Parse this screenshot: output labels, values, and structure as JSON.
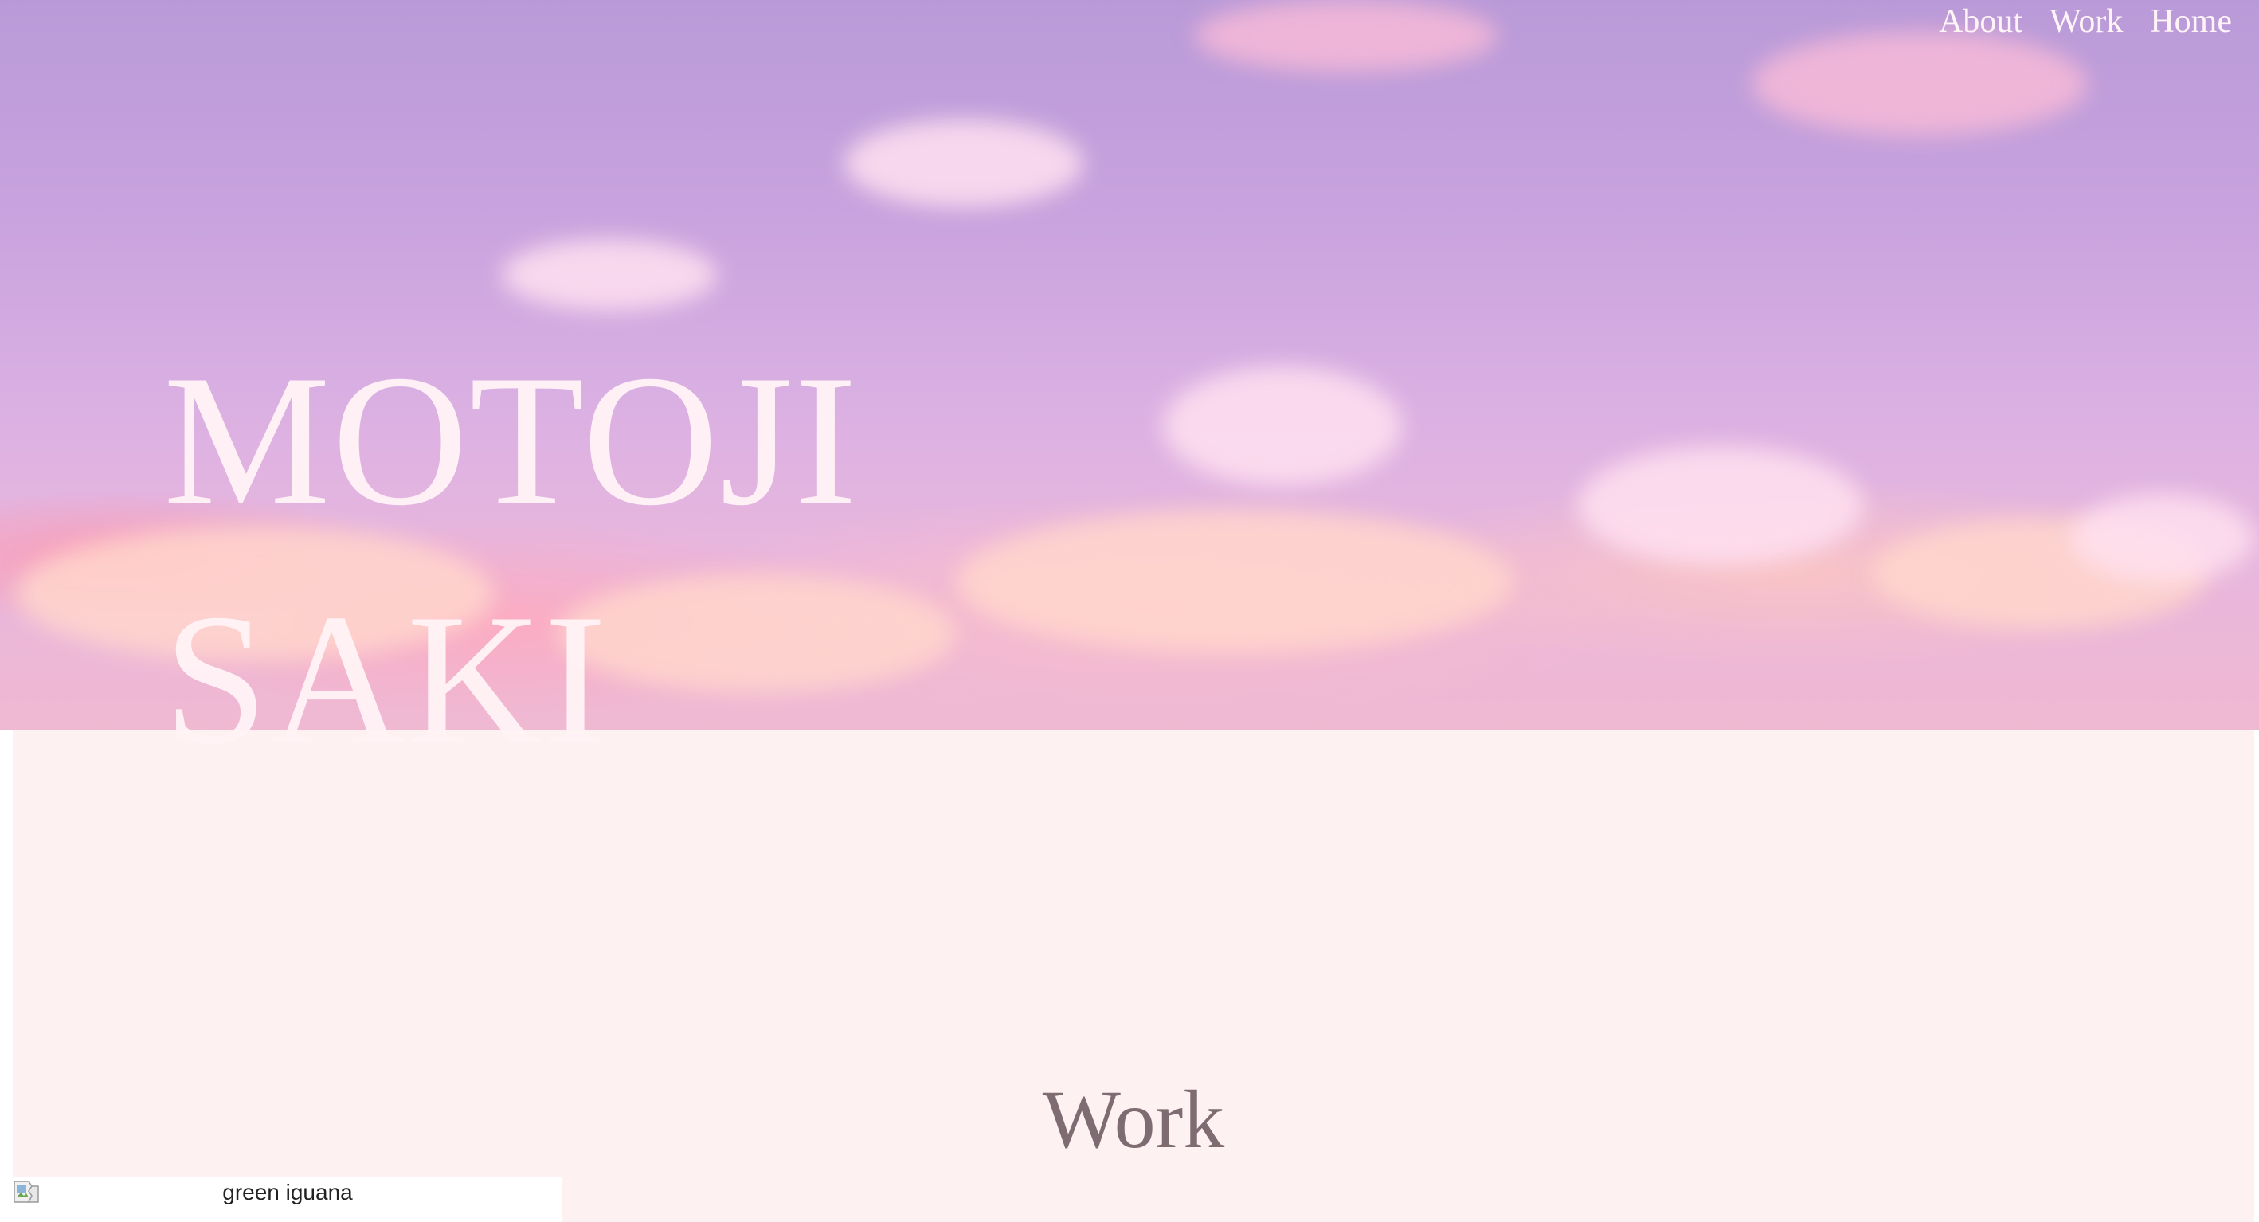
{
  "nav": {
    "items": [
      {
        "label": "About"
      },
      {
        "label": "Work"
      },
      {
        "label": "Home"
      }
    ]
  },
  "hero": {
    "title_line1": "MOTOJI",
    "title_line2": "SAKI",
    "background": "pink-purple-sky-clouds"
  },
  "work": {
    "heading": "Work",
    "items": [
      {
        "image_alt": "green iguana",
        "image_state": "broken-image-icon"
      }
    ]
  },
  "colors": {
    "page_background": "#fdf1f1",
    "heading_color": "#7e6c72",
    "hero_text_color": "#fff3f6",
    "sky_top": "#b99ad8",
    "sky_bottom": "#f0b9d2"
  }
}
